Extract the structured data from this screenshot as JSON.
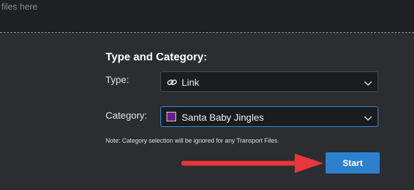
{
  "drop_zone": {
    "hint": "files here"
  },
  "form": {
    "title": "Type and Category:",
    "type": {
      "label": "Type:",
      "value": "Link",
      "icon": "link-icon"
    },
    "category": {
      "label": "Category:",
      "value": "Santa Baby Jingles",
      "swatch_color": "#6a1f87",
      "focus_color": "#3a8ee6"
    },
    "note": "Note: Category selection will be ignored for any Transport Files.",
    "start_label": "Start"
  },
  "colors": {
    "background": "#2b2d31",
    "accent": "#2f7fcf",
    "annotation_arrow": "#e8363c"
  }
}
